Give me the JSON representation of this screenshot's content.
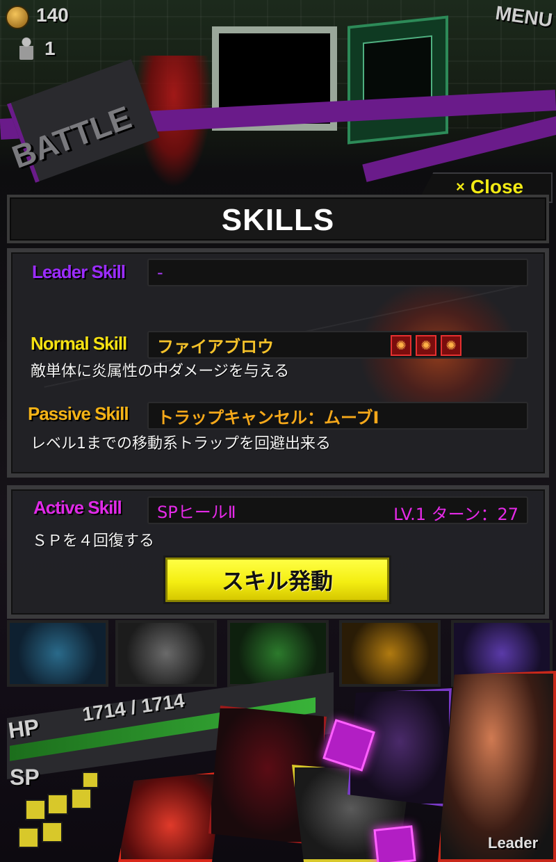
{
  "status": {
    "coins": "140",
    "keys": "1",
    "menu_label": "MENU",
    "battle_label": "BATTLE"
  },
  "dialog": {
    "title": "SKILLS",
    "close_label": "Close",
    "close_icon": "×",
    "leader": {
      "label": "Leader Skill",
      "value": "-"
    },
    "normal": {
      "label": "Normal Skill",
      "value": "ファイアブロウ",
      "description": "敵単体に炎属性の中ダメージを与える",
      "element_icons": [
        "fire-icon",
        "fire-icon",
        "fire-icon"
      ]
    },
    "passive": {
      "label": "Passive Skill",
      "value": "トラップキャンセル：ムーブⅠ",
      "description": "レベル1までの移動系トラップを回避出来る"
    },
    "active": {
      "label": "Active Skill",
      "value": "SPヒールⅡ",
      "level_turn": "LV.1 ターン：27",
      "description": "ＳＰを４回復する",
      "activate_label": "スキル発動"
    }
  },
  "hud": {
    "hp_label": "HP",
    "hp_value": "1714 / 1714",
    "hp_fraction": 1.0,
    "sp_label": "SP",
    "leader_tag": "Leader"
  },
  "colors": {
    "leader_skill": "#9b2cff",
    "normal_skill": "#f5e112",
    "passive_skill": "#f5b316",
    "active_skill": "#e02ae8",
    "close_yellow": "#f2ea14",
    "activate_button": "#f4ee12"
  }
}
